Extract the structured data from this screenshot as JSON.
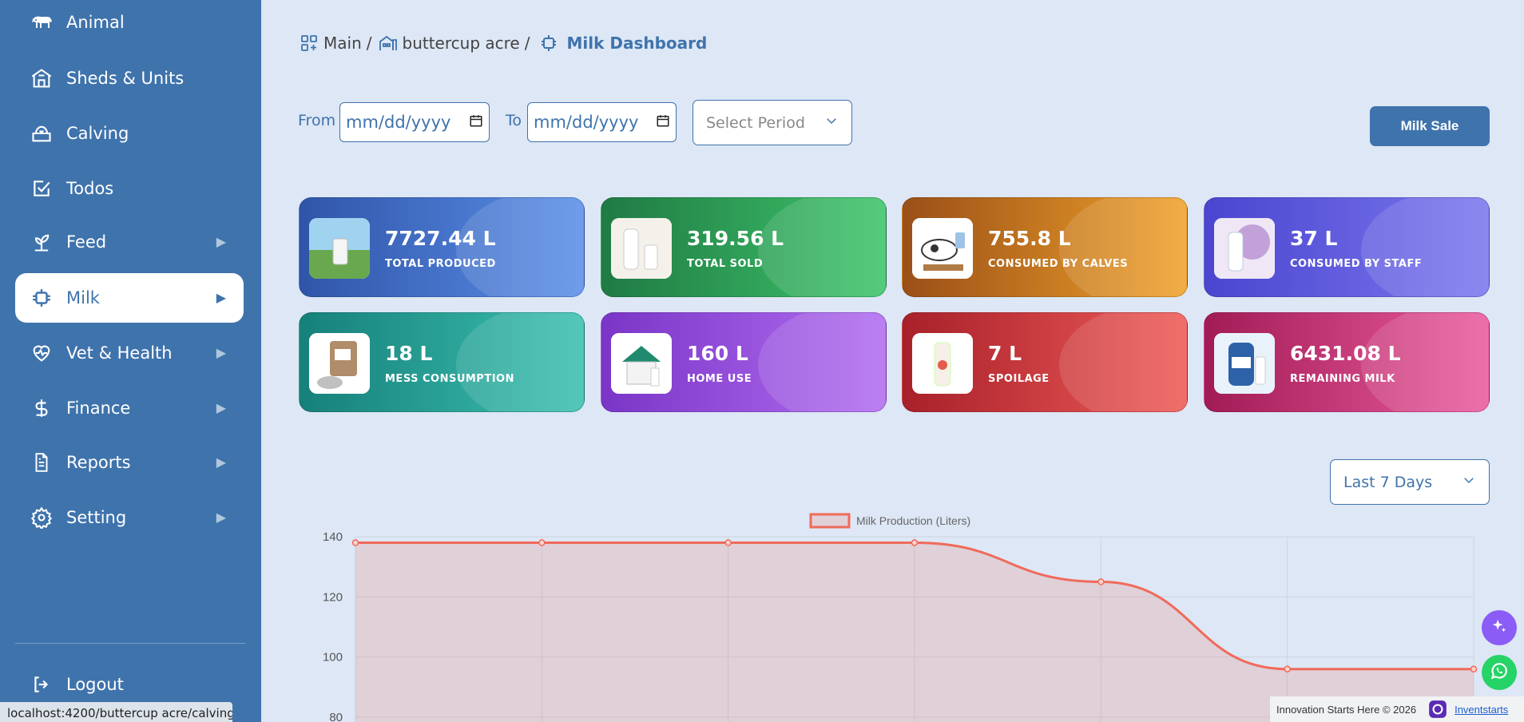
{
  "sidebar": {
    "items": [
      {
        "label": "Animal",
        "icon": "cow-icon",
        "has_arrow": false
      },
      {
        "label": "Sheds & Units",
        "icon": "shed-icon",
        "has_arrow": false
      },
      {
        "label": "Calving",
        "icon": "calving-icon",
        "has_arrow": false
      },
      {
        "label": "Todos",
        "icon": "checkbox-icon",
        "has_arrow": false
      },
      {
        "label": "Feed",
        "icon": "sprout-icon",
        "has_arrow": true
      },
      {
        "label": "Milk",
        "icon": "milk-can-icon",
        "has_arrow": true,
        "active": true
      },
      {
        "label": "Vet & Health",
        "icon": "heart-pulse-icon",
        "has_arrow": true
      },
      {
        "label": "Finance",
        "icon": "dollar-icon",
        "has_arrow": true
      },
      {
        "label": "Reports",
        "icon": "document-icon",
        "has_arrow": true
      },
      {
        "label": "Setting",
        "icon": "gear-icon",
        "has_arrow": true
      }
    ],
    "logout_label": "Logout",
    "arrow": "▶"
  },
  "status_url": "localhost:4200/buttercup acre/calving",
  "breadcrumb": {
    "main": "Main",
    "farm": "buttercup acre",
    "current": "Milk Dashboard",
    "separator": "/"
  },
  "filters": {
    "from_label": "From",
    "to_label": "To",
    "from_value": "mm/dd/yyyy",
    "to_value": "mm/dd/yyyy",
    "period_placeholder": "Select Period"
  },
  "milk_sale_label": "Milk Sale",
  "cards": [
    {
      "value": "7727.44 L",
      "caption": "TOTAL PRODUCED",
      "color_from": "#2f55a8",
      "color_to": "#5b8fe8"
    },
    {
      "value": "319.56 L",
      "caption": "TOTAL SOLD",
      "color_from": "#1f7a44",
      "color_to": "#3ec46a"
    },
    {
      "value": "755.8 L",
      "caption": "CONSUMED BY CALVES",
      "color_from": "#9a4f17",
      "color_to": "#f0a22b"
    },
    {
      "value": "37 L",
      "caption": "CONSUMED BY STAFF",
      "color_from": "#4a45cf",
      "color_to": "#7b78ee"
    },
    {
      "value": "18 L",
      "caption": "MESS CONSUMPTION",
      "color_from": "#16807a",
      "color_to": "#3cc0b0"
    },
    {
      "value": "160 L",
      "caption": "HOME USE",
      "color_from": "#7a35c7",
      "color_to": "#b26ef0"
    },
    {
      "value": "7 L",
      "caption": "SPOILAGE",
      "color_from": "#a8202a",
      "color_to": "#ee5b57"
    },
    {
      "value": "6431.08 L",
      "caption": "REMAINING MILK",
      "color_from": "#a11b55",
      "color_to": "#eb5c9f"
    }
  ],
  "chart_period": "Last 7 Days",
  "chart_data": {
    "type": "area",
    "series": [
      {
        "name": "Milk Production (Liters)",
        "values": [
          138,
          138,
          138,
          138,
          125,
          96,
          96
        ]
      }
    ],
    "y_ticks": [
      140,
      120,
      100,
      80
    ],
    "ylim": [
      70,
      145
    ],
    "grid": true,
    "legend": "top-center",
    "line_color": "#f06a5a",
    "fill_color": "rgba(240,106,90,0.18)"
  },
  "footer": {
    "text": "Innovation Starts Here © 2026",
    "brand": "Inventstarts"
  }
}
